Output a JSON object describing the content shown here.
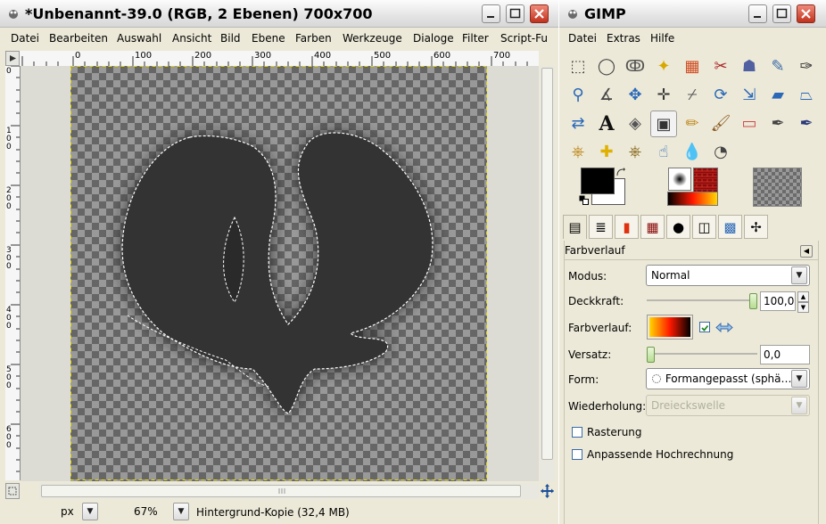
{
  "image_window": {
    "title": "*Unbenannt-39.0 (RGB, 2 Ebenen) 700x700",
    "menu": [
      "Datei",
      "Bearbeiten",
      "Auswahl",
      "Ansicht",
      "Bild",
      "Ebene",
      "Farben",
      "Werkzeuge",
      "Dialoge",
      "Filter",
      "Script-Fu"
    ],
    "ruler_h_labels": [
      "0",
      "100",
      "200",
      "300",
      "400",
      "500",
      "600",
      "700"
    ],
    "ruler_v_labels": [
      "0",
      "100",
      "200",
      "300",
      "400",
      "500",
      "600"
    ],
    "status": {
      "unit": "px",
      "zoom": "67%",
      "layer_info": "Hintergrund-Kopie (32,4 MB)"
    }
  },
  "toolbox_window": {
    "title": "GIMP",
    "menu": [
      "Datei",
      "Extras",
      "Hilfe"
    ],
    "tools": [
      "rect-select-icon",
      "ellipse-select-icon",
      "free-select-icon",
      "fuzzy-select-icon",
      "color-select-icon",
      "scissors-icon",
      "foreground-select-icon",
      "paths-icon",
      "color-picker-icon",
      "zoom-icon",
      "measure-icon",
      "move-icon",
      "align-icon",
      "crop-icon",
      "rotate-icon",
      "scale-icon",
      "shear-icon",
      "perspective-icon",
      "flip-icon",
      "text-icon",
      "bucket-fill-icon",
      "blend-icon",
      "pencil-icon",
      "paintbrush-icon",
      "eraser-icon",
      "airbrush-icon",
      "ink-icon",
      "clone-icon",
      "heal-icon",
      "perspective-clone-icon",
      "smudge-icon",
      "convolve-icon",
      "dodge-burn-icon"
    ],
    "active_tool": "blend-icon",
    "colors": {
      "foreground": "#000000",
      "background": "#ffffff"
    },
    "tabs": [
      "tool-options-tab",
      "layers-tab",
      "gradients-tab",
      "patterns-tab",
      "brushes-tab",
      "images-tab",
      "palettes-tab",
      "paths-tab"
    ],
    "options": {
      "panel_title": "Farbverlauf",
      "modus_label": "Modus:",
      "modus_value": "Normal",
      "deckkraft_label": "Deckkraft:",
      "deckkraft_value": "100,0",
      "deckkraft_level": 1.0,
      "farbverlauf_label": "Farbverlauf:",
      "versatz_label": "Versatz:",
      "versatz_value": "0,0",
      "versatz_level": 0.0,
      "form_label": "Form:",
      "form_value": "Formangepasst (sphä…",
      "wiederholung_label": "Wiederholung:",
      "wiederholung_value": "Dreieckswelle",
      "rasterung_label": "Rasterung",
      "rasterung_checked": false,
      "hochrechnung_label": "Anpassende Hochrechnung",
      "hochrechnung_checked": false,
      "reverse_checked": true
    }
  }
}
